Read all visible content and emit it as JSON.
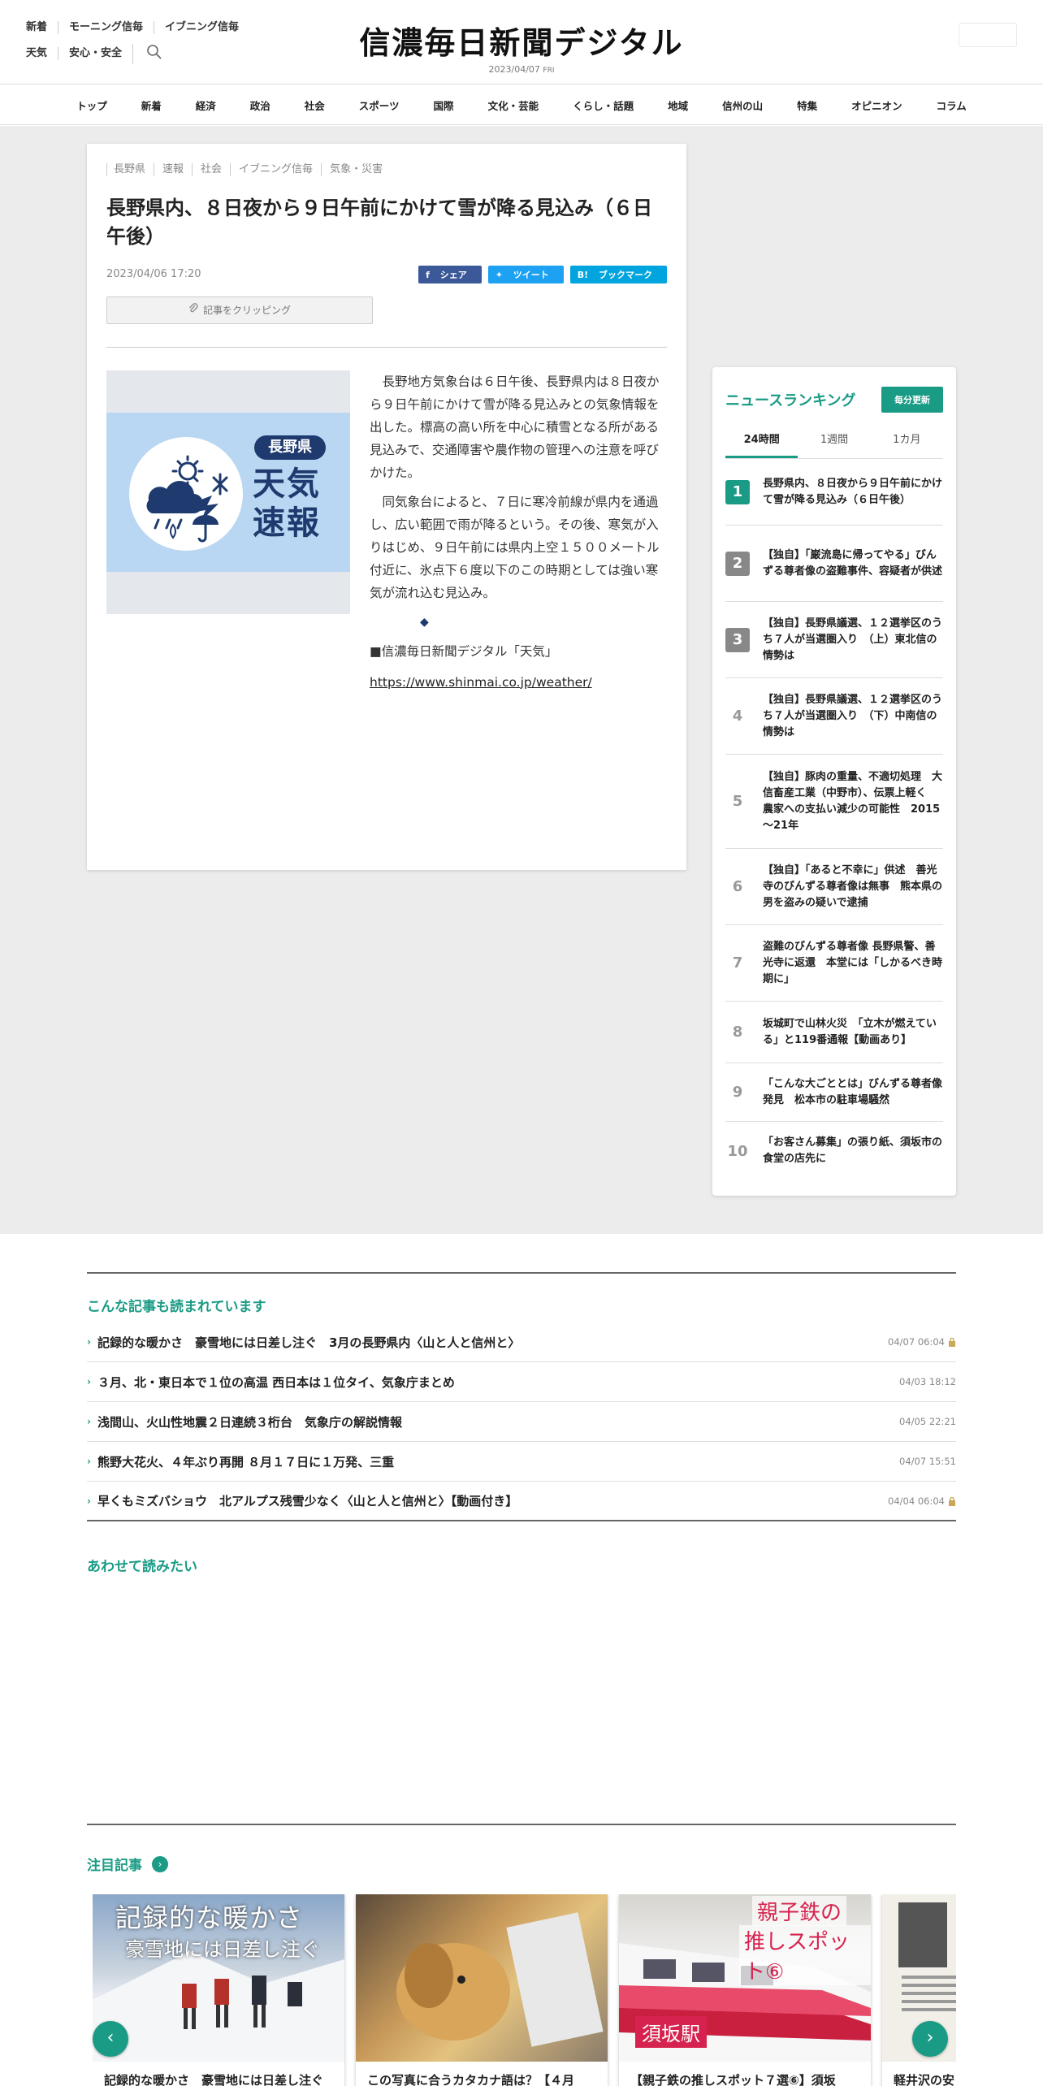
{
  "header": {
    "links_row1": [
      "新着",
      "モーニング信毎",
      "イブニング信毎"
    ],
    "links_row2": [
      "天気",
      "安心・安全"
    ],
    "logo": "信濃毎日新聞デジタル",
    "date": "2023/04/07",
    "weekday": "FRI"
  },
  "nav": [
    "トップ",
    "新着",
    "経済",
    "政治",
    "社会",
    "スポーツ",
    "国際",
    "文化・芸能",
    "くらし・話題",
    "地域",
    "信州の山",
    "特集",
    "オピニオン",
    "コラム"
  ],
  "article": {
    "tags": [
      "長野県",
      "速報",
      "社会",
      "イブニング信毎",
      "気象・災害"
    ],
    "headline": "長野県内、８日夜から９日午前にかけて雪が降る見込み（６日午後）",
    "date": "2023/04/06 17:20",
    "share_fb": "シェア",
    "share_tw": "ツイート",
    "share_hb": "ブックマーク",
    "clip": "記事をクリッピング",
    "image": {
      "pref": "長野県",
      "line1": "天気",
      "line2": "速報"
    },
    "para1": "長野地方気象台は６日午後、長野県内は８日夜から９日午前にかけて雪が降る見込みとの気象情報を出した。標高の高い所を中心に積雪となる所がある見込みで、交通障害や農作物の管理への注意を呼びかけた。",
    "para2": "同気象台によると、７日に寒冷前線が県内を通過し、広い範囲で雨が降るという。その後、寒気が入りはじめ、９日午前には県内上空１５００メートル付近に、氷点下６度以下のこの時期としては強い寒気が流れ込む見込み。",
    "diamond": "◆",
    "source": "■信濃毎日新聞デジタル「天気」",
    "url": "https://www.shinmai.co.jp/weather/"
  },
  "ranking": {
    "title": "ニュースランキング",
    "badge": "毎分更新",
    "tabs": [
      "24時間",
      "1週間",
      "1カ月"
    ],
    "items": [
      {
        "rank": "1",
        "text": "長野県内、８日夜から９日午前にかけて雪が降る見込み（６日午後）"
      },
      {
        "rank": "2",
        "text": "【独自】「巌流島に帰ってやる」びんずる尊者像の盗難事件、容疑者が供述"
      },
      {
        "rank": "3",
        "text": "【独自】長野県議選、１２選挙区のうち７人が当選圏入り　（上）東北信の情勢は"
      },
      {
        "rank": "4",
        "text": "【独自】長野県議選、１２選挙区のうち７人が当選圏入り　（下）中南信の情勢は"
      },
      {
        "rank": "5",
        "text": "【独自】豚肉の重量、不適切処理　大信畜産工業（中野市）、伝票上軽く　農家への支払い減少の可能性　2015～21年"
      },
      {
        "rank": "6",
        "text": "【独自】「あると不幸に」供述　善光寺のびんずる尊者像は無事　熊本県の男を盗みの疑いで逮捕"
      },
      {
        "rank": "7",
        "text": "盗難のびんずる尊者像 長野県警、善光寺に返還　本堂には「しかるべき時期に」"
      },
      {
        "rank": "8",
        "text": "坂城町で山林火災　「立木が燃えている」と119番通報【動画あり】"
      },
      {
        "rank": "9",
        "text": "「こんな大ごととは」びんずる尊者像発見　松本市の駐車場騒然"
      },
      {
        "rank": "10",
        "text": "「お客さん募集」の張り紙、須坂市の食堂の店先に"
      }
    ]
  },
  "related": {
    "title": "こんな記事も読まれています",
    "items": [
      {
        "text": "記録的な暖かさ　豪雪地には日差し注ぐ　3月の長野県内〈山と人と信州と〉",
        "time": "04/07 06:04",
        "locked": true
      },
      {
        "text": "３月、北・東日本で１位の高温 西日本は１位タイ、気象庁まとめ",
        "time": "04/03 18:12",
        "locked": false
      },
      {
        "text": "浅間山、火山性地震２日連続３桁台　気象庁の解説情報",
        "time": "04/05 22:21",
        "locked": false
      },
      {
        "text": "熊野大花火、４年ぶり再開 ８月１７日に１万発、三重",
        "time": "04/07 15:51",
        "locked": false
      },
      {
        "text": "早くもミズバショウ　北アルプス残雪少なく〈山と人と信州と〉【動画付き】",
        "time": "04/04 06:04",
        "locked": true
      }
    ]
  },
  "also_read": {
    "title": "あわせて読みたい"
  },
  "featured": {
    "title": "注目記事",
    "cards": [
      {
        "caption": "記録的な暖かさ　豪雪地には日差し注ぐ",
        "img_line1": "記録的な暖かさ",
        "img_line2": "豪雪地には日差し注ぐ"
      },
      {
        "caption": "この写真に合うカタカナ語は？【４月"
      },
      {
        "caption": "【親子鉄の推しスポット７選⑥】須坂",
        "img_line1": "親子鉄の",
        "img_line2": "推しスポット⑥",
        "img_station": "須坂駅"
      },
      {
        "caption": "軽井沢の安"
      }
    ],
    "prev": "‹",
    "next": "›"
  },
  "colors": {
    "accent": "#1a9b85",
    "navy": "#1e3a6e",
    "background_gray": "#ececec"
  }
}
